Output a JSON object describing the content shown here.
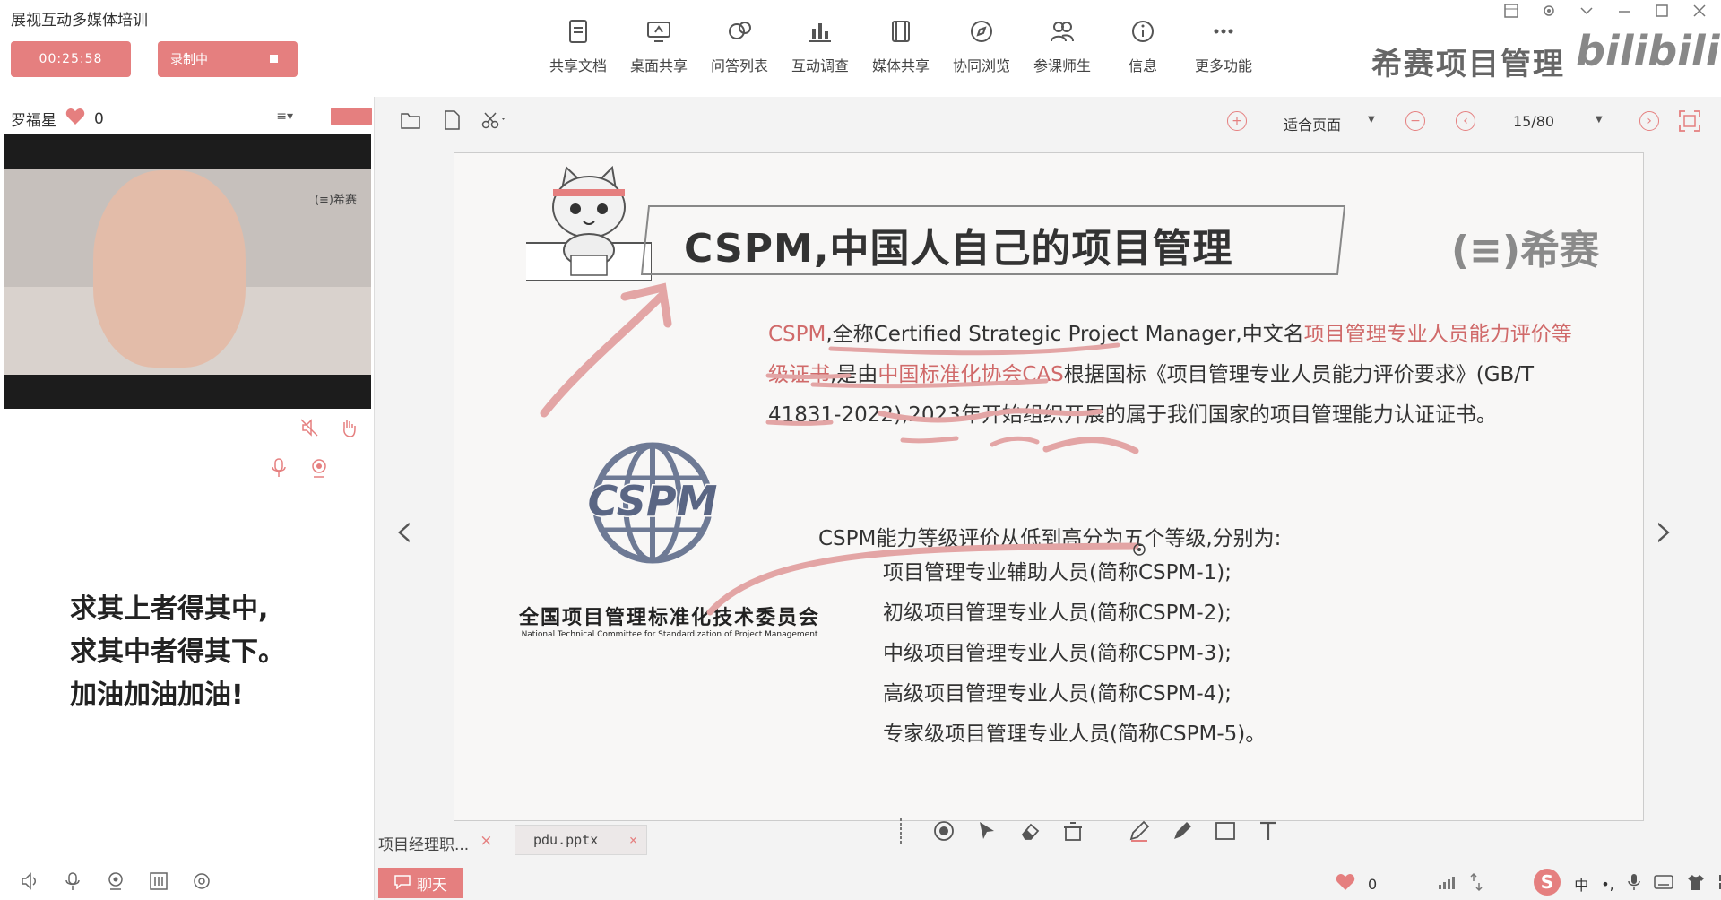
{
  "app": {
    "title": "展视互动多媒体培训"
  },
  "header": {
    "timer": "00:25:58",
    "record_label": "录制中",
    "brand": "希赛项目管理",
    "bili_logo": "bilibili"
  },
  "toolbar": {
    "items": [
      {
        "label": "共享文档",
        "icon": "document-icon"
      },
      {
        "label": "桌面共享",
        "icon": "desktop-share-icon"
      },
      {
        "label": "问答列表",
        "icon": "qa-icon"
      },
      {
        "label": "互动调查",
        "icon": "survey-icon"
      },
      {
        "label": "媒体共享",
        "icon": "media-icon"
      },
      {
        "label": "协同浏览",
        "icon": "compass-icon"
      },
      {
        "label": "参课师生",
        "icon": "users-icon"
      },
      {
        "label": "信息",
        "icon": "info-icon"
      },
      {
        "label": "更多功能",
        "icon": "more-icon"
      }
    ]
  },
  "left": {
    "user_name": "罗福星",
    "like_count": "0",
    "video_logo": "(≡)希赛",
    "motto": [
      "求其上者得其中,",
      "求其中者得其下。",
      "加油加油加油!"
    ]
  },
  "slide_toolbar": {
    "fit": "适合页面",
    "page": "15/80"
  },
  "slide": {
    "title": "CSPM,中国人自己的项目管理",
    "brand": "(≡)希赛",
    "para": {
      "p1": "CSPM",
      "p2": ",全称Certified Strategic Project Manager,中文名",
      "p3": "项目管理专业人员能力评价等级证书",
      "p4": ",是由",
      "p5": "中国标准化协会CAS",
      "p6": "根据国标《项目管理专业人员能力评价要求》(GB/T 41831-2022),2023年开始组织开展的属于我们国家的项目管理能力认证证书。"
    },
    "logo_text": "CSPM",
    "committee_cn": "全国项目管理标准化技术委员会",
    "committee_en": "National Technical Committee for Standardization of Project Management",
    "levels_title": "CSPM能力等级评价从低到高分为五个等级,分别为:",
    "levels": [
      "项目管理专业辅助人员(简称CSPM-1);",
      "初级项目管理专业人员(简称CSPM-2);",
      "中级项目管理专业人员(简称CSPM-3);",
      "高级项目管理专业人员(简称CSPM-4);",
      "专家级项目管理专业人员(简称CSPM-5)。"
    ]
  },
  "bottom": {
    "tab1": "项目经理职...",
    "tab2": "pdu.pptx",
    "chat": "聊天",
    "likes": "0",
    "ime": "中"
  },
  "colors": {
    "accent": "#e57f7f",
    "highlight": "#d06a6a"
  }
}
